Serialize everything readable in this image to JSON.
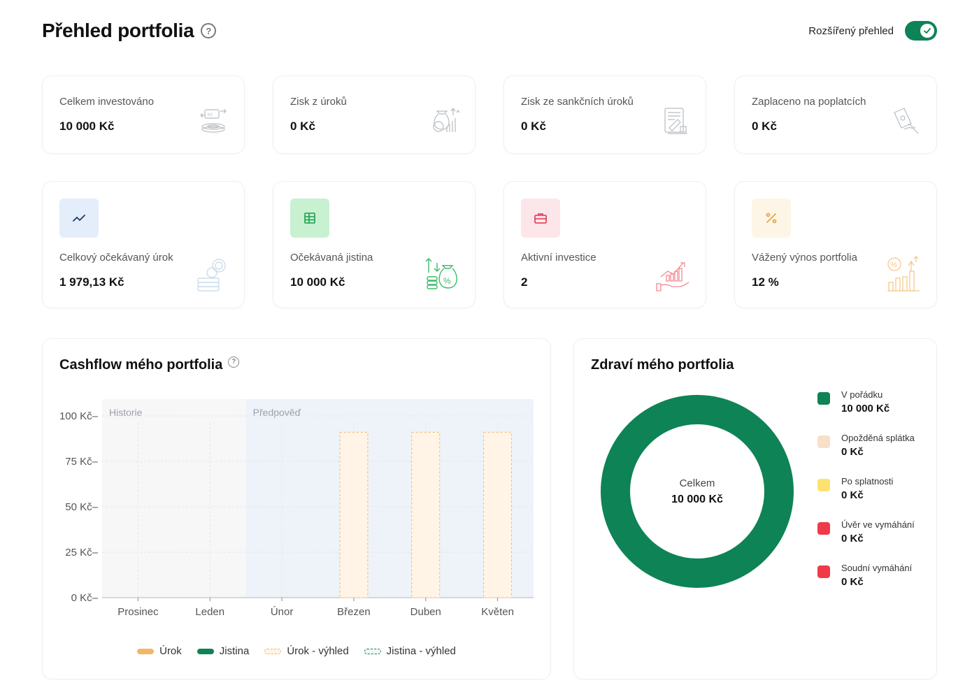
{
  "header": {
    "title": "Přehled portfolia",
    "toggle_label": "Rozšířený přehled",
    "toggle_on": true
  },
  "stats_row1": [
    {
      "label": "Celkem investováno",
      "value": "10 000 Kč",
      "icon": "money-transfer-icon"
    },
    {
      "label": "Zisk z úroků",
      "value": "0 Kč",
      "icon": "money-bag-growth-icon"
    },
    {
      "label": "Zisk ze sankčních úroků",
      "value": "0 Kč",
      "icon": "document-penalty-icon"
    },
    {
      "label": "Zaplaceno na poplatcích",
      "value": "0 Kč",
      "icon": "hand-payment-icon"
    }
  ],
  "stats_row2": [
    {
      "label": "Celkový očekávaný úrok",
      "value": "1 979,13 Kč",
      "icon": "coins-stack-icon",
      "badge_icon": "trend-line-icon",
      "badge_color": "#e3eefa"
    },
    {
      "label": "Očekávaná jistina",
      "value": "10 000 Kč",
      "icon": "money-bag-percent-icon",
      "badge_icon": "table-icon",
      "badge_color": "#c8f1d2"
    },
    {
      "label": "Aktivní investice",
      "value": "2",
      "icon": "hand-growth-chart-icon",
      "badge_icon": "briefcase-icon",
      "badge_color": "#fde6ea"
    },
    {
      "label": "Vážený výnos portfolia",
      "value": "12 %",
      "icon": "percent-bar-chart-icon",
      "badge_icon": "percent-icon",
      "badge_color": "#fdf6e6"
    }
  ],
  "cashflow": {
    "title": "Cashflow mého portfolia",
    "section_history": "Historie",
    "section_forecast": "Předpověď",
    "legend": [
      {
        "label": "Úrok",
        "color": "#f2b766",
        "style": "solid"
      },
      {
        "label": "Jistina",
        "color": "#0e8356",
        "style": "solid"
      },
      {
        "label": "Úrok - výhled",
        "color": "#f2b766",
        "style": "dashed"
      },
      {
        "label": "Jistina - výhled",
        "color": "#0e8356",
        "style": "dashed"
      }
    ]
  },
  "chart_data": {
    "type": "bar",
    "categories": [
      "Prosinec",
      "Leden",
      "Únor",
      "Březen",
      "Duben",
      "Květen"
    ],
    "series": [
      {
        "name": "Úrok",
        "values": [
          0,
          0,
          0,
          0,
          0,
          0
        ]
      },
      {
        "name": "Jistina",
        "values": [
          0,
          0,
          0,
          0,
          0,
          0
        ]
      },
      {
        "name": "Úrok - výhled",
        "values": [
          0,
          0,
          0,
          91,
          91,
          91
        ]
      },
      {
        "name": "Jistina - výhled",
        "values": [
          0,
          0,
          0,
          0,
          0,
          0
        ]
      }
    ],
    "ylim": [
      0,
      100
    ],
    "yticks": [
      "0 Kč",
      "25 Kč",
      "50 Kč",
      "75 Kč",
      "100 Kč"
    ],
    "ytick_values": [
      0,
      25,
      50,
      75,
      100
    ],
    "history_categories": 2,
    "grid": true,
    "legend_position": "bottom"
  },
  "health": {
    "title": "Zdraví mého portfolia",
    "center_label": "Celkem",
    "center_value": "10 000 Kč",
    "items": [
      {
        "label": "V pořádku",
        "value": "10 000 Kč",
        "color": "#0e8356"
      },
      {
        "label": "Opožděná splátka",
        "value": "0 Kč",
        "color": "#f8e0c8"
      },
      {
        "label": "Po splatnosti",
        "value": "0 Kč",
        "color": "#fde272"
      },
      {
        "label": "Úvěr ve vymáhání",
        "value": "0 Kč",
        "color": "#ef3b47"
      },
      {
        "label": "Soudní vymáhání",
        "value": "0 Kč",
        "color": "#ef3b47"
      }
    ]
  }
}
